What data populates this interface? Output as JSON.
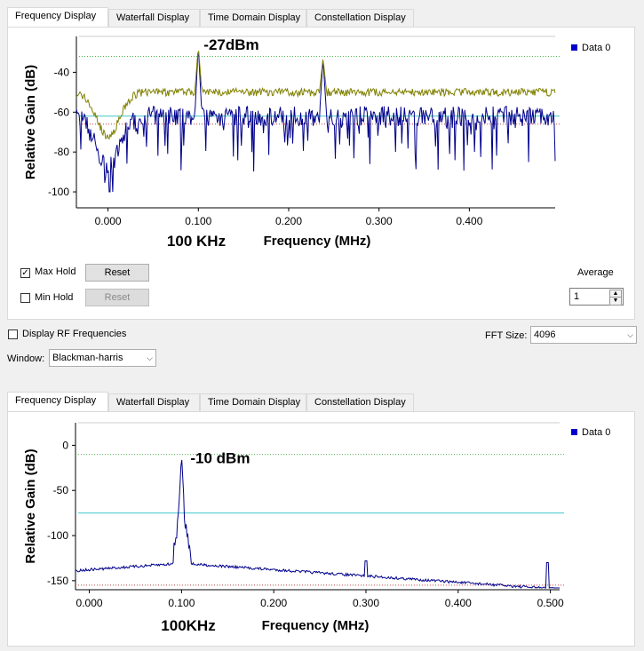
{
  "top": {
    "tabs": [
      "Frequency Display",
      "Waterfall Display",
      "Time Domain Display",
      "Constellation Display"
    ],
    "chart_data": {
      "type": "line",
      "xlabel": "Frequency (MHz)",
      "ylabel": "Relative Gain (dB)",
      "xticks": [
        "0.000",
        "0.100",
        "0.200",
        "0.300",
        "0.400"
      ],
      "yticks": [
        "-40",
        "-60",
        "-80",
        "-100"
      ],
      "xlim": [
        -0.035,
        0.495
      ],
      "ylim": [
        -108,
        -22
      ],
      "legend": "Data 0",
      "annotation": "-27dBm",
      "below_axis_note": "100 KHz",
      "peaks": [
        {
          "x": 0.1,
          "y": -27
        },
        {
          "x": 0.238,
          "y": -33
        }
      ],
      "upper_marker_db": -32,
      "avg_line_db": -62,
      "lower_marker_db": -66,
      "maxhold_level_db": -50,
      "noise_level_db": -62,
      "dip_center_mhz": 0.0,
      "dip_min_db": -94,
      "series_color": "#00008b",
      "maxhold_color": "#808000"
    },
    "max_hold_label": "Max Hold",
    "min_hold_label": "Min Hold",
    "reset_label": "Reset",
    "average_label": "Average",
    "average_value": "1"
  },
  "controls": {
    "display_rf_label": "Display RF Frequencies",
    "fft_size_label": "FFT Size:",
    "fft_size_value": "4096",
    "window_label": "Window:",
    "window_value": "Blackman-harris"
  },
  "bottom": {
    "tabs": [
      "Frequency Display",
      "Waterfall Display",
      "Time Domain Display",
      "Constellation Display"
    ],
    "chart_data": {
      "type": "line",
      "xlabel": "Frequency (MHz)",
      "ylabel": "Relative Gain (dB)",
      "xticks": [
        "0.000",
        "0.100",
        "0.200",
        "0.300",
        "0.400",
        "0.500"
      ],
      "yticks": [
        "0",
        "-50",
        "-100",
        "-150"
      ],
      "xlim": [
        -0.015,
        0.51
      ],
      "ylim": [
        -160,
        25
      ],
      "legend": "Data 0",
      "annotation": "-10 dBm",
      "below_axis_note": "100KHz",
      "peaks": [
        {
          "x": 0.1,
          "y": -10
        }
      ],
      "upper_marker_db": -10,
      "avg_line_db": -75,
      "lower_marker_db": -155,
      "series_color": "#00008b"
    }
  }
}
